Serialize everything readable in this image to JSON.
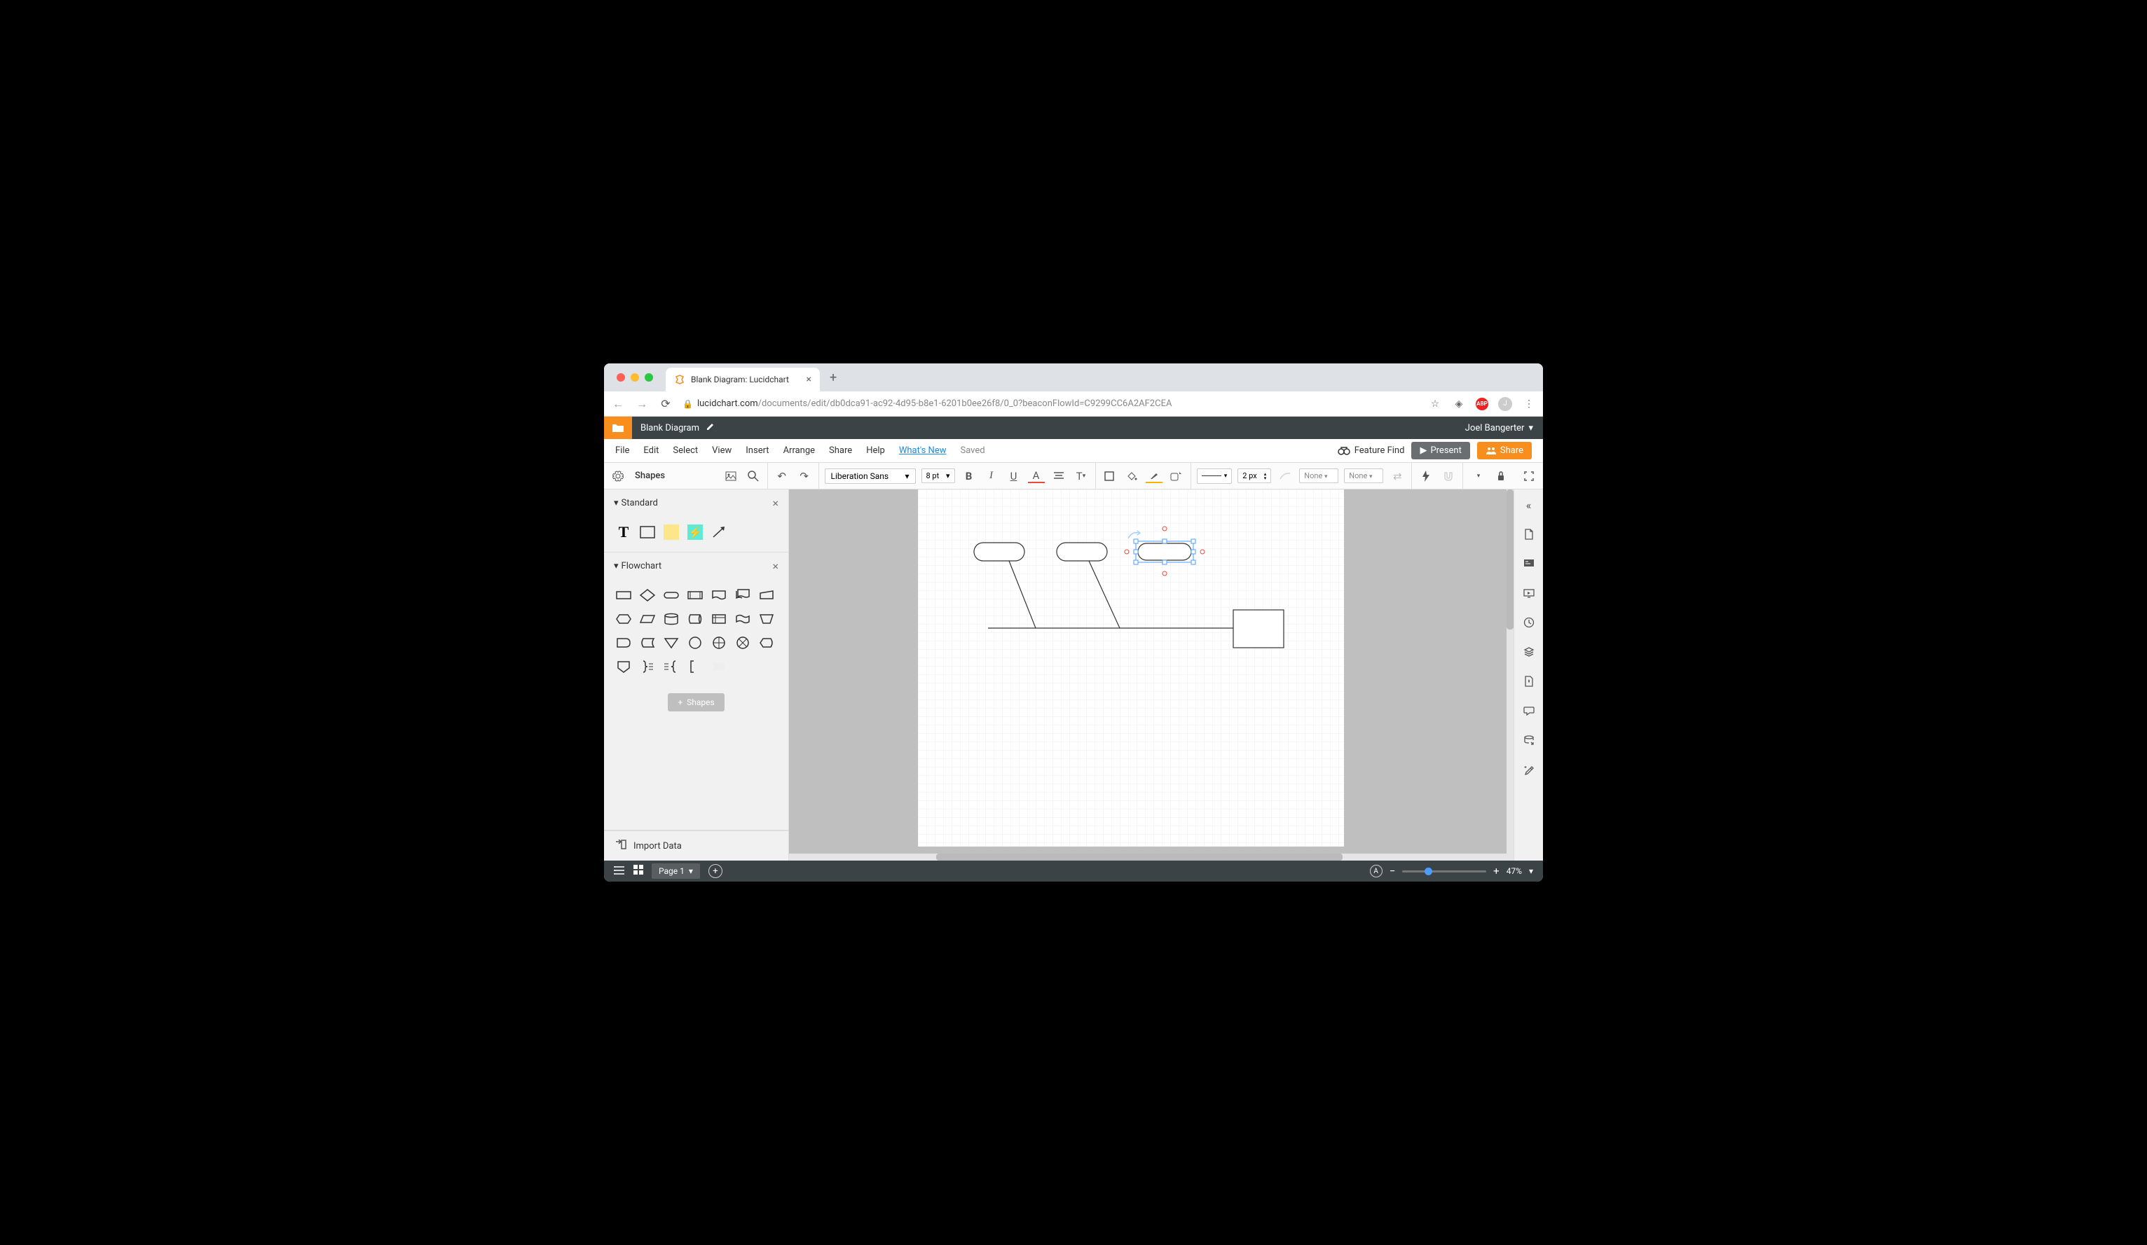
{
  "browser": {
    "tab_title": "Blank Diagram: Lucidchart",
    "url_domain": "lucidchart.com",
    "url_path": "/documents/edit/db0dca91-ac92-4d95-b8e1-6201b0ee26f8/0_0?beaconFlowId=C9299CC6A2AF2CEA",
    "avatar_letter": "J",
    "abp_label": "ABP"
  },
  "app": {
    "doc_title": "Blank Diagram",
    "user_name": "Joel Bangerter"
  },
  "menu": {
    "items": [
      "File",
      "Edit",
      "Select",
      "View",
      "Insert",
      "Arrange",
      "Share",
      "Help"
    ],
    "whats_new": "What's New",
    "saved": "Saved",
    "feature_find": "Feature Find",
    "present": "Present",
    "share": "Share"
  },
  "toolbar": {
    "shapes_label": "Shapes",
    "font": "Liberation Sans",
    "font_size": "8 pt",
    "line_width": "2 px",
    "endpoint_none_1": "None",
    "endpoint_none_2": "None"
  },
  "shape_panel": {
    "standard_label": "Standard",
    "flowchart_label": "Flowchart",
    "shapes_btn": "Shapes",
    "import_data": "Import Data"
  },
  "status": {
    "page_label": "Page 1",
    "zoom_label": "47%"
  }
}
